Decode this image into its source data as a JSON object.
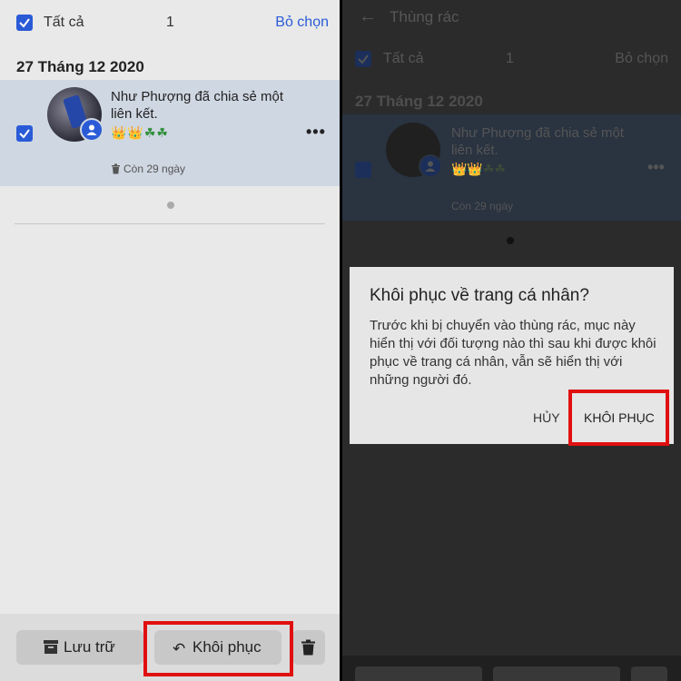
{
  "left": {
    "select_all_label": "Tất cả",
    "selected_count": "1",
    "deselect_label": "Bỏ chọn",
    "date_header": "27 Tháng 12 2020",
    "item": {
      "text": "Như Phượng đã chia sẻ một liên kết.",
      "emoji": "👑👑☘☘",
      "days_left": "Còn 29 ngày"
    },
    "bottom": {
      "archive_label": "Lưu trữ",
      "restore_label": "Khôi phục",
      "restore_icon": "↶"
    }
  },
  "right": {
    "back_icon": "←",
    "title": "Thùng rác",
    "select_all_label": "Tất cả",
    "selected_count": "1",
    "deselect_label": "Bỏ chọn",
    "date_header": "27 Tháng 12 2020",
    "item": {
      "text": "Như Phượng đã chia sẻ một liên kết.",
      "emoji": "👑👑☘☘",
      "days_left": "Còn 29 ngày"
    },
    "dialog": {
      "title": "Khôi phục về trang cá nhân?",
      "body": "Trước khi bị chuyển vào thùng rác, mục này hiển thị với đối tượng nào thì sau khi được khôi phục về trang cá nhân, vẫn sẽ hiển thị với những người đó.",
      "cancel_label": "HỦY",
      "restore_label": "KHÔI PHỤC"
    }
  },
  "colors": {
    "accent": "#2a5bd7",
    "highlight": "#e01010",
    "selected_item_bg": "#cfd7e2"
  }
}
